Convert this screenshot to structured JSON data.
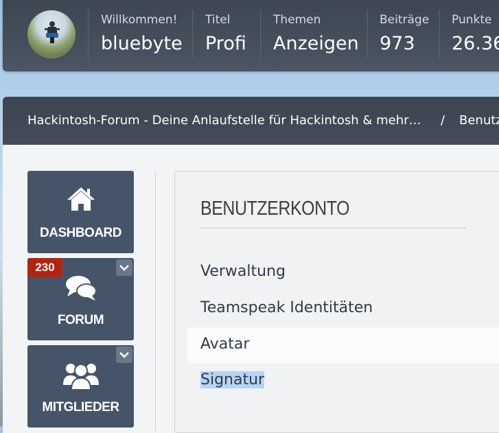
{
  "user_bar": {
    "welcome_label": "Willkommen!",
    "username": "bluebyte",
    "title_label": "Titel",
    "title_value": "Profi",
    "themes_label": "Themen",
    "themes_value": "Anzeigen",
    "posts_label": "Beiträge",
    "posts_value": "973",
    "points_label": "Punkte",
    "points_value": "26.36"
  },
  "breadcrumb": {
    "item1": "Hackintosh-Forum - Deine Anlaufstelle für Hackintosh & mehr…",
    "separator": "/",
    "item2": "Benutz"
  },
  "sidebar": {
    "tiles": [
      {
        "label": "DASHBOARD",
        "icon": "home-icon"
      },
      {
        "label": "FORUM",
        "icon": "chat-bubbles-icon",
        "badge": "230"
      },
      {
        "label": "MITGLIEDER",
        "icon": "users-icon"
      }
    ]
  },
  "panel": {
    "title": "BENUTZERKONTO",
    "items": [
      "Verwaltung",
      "Teamspeak Identitäten",
      "Avatar",
      "Signatur"
    ]
  },
  "colors": {
    "tile_bg": "#46546a",
    "badge_bg": "#b2240f",
    "header_bg": "#3d4652",
    "selection": "#b6d4f6"
  }
}
